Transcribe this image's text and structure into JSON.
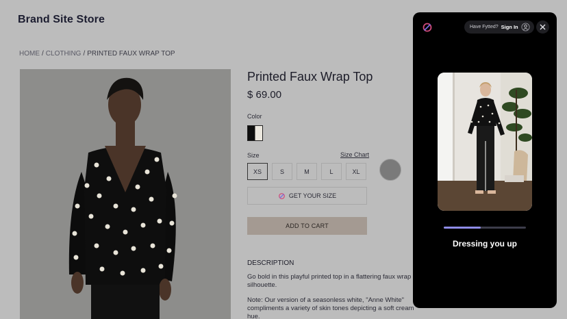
{
  "store": {
    "title": "Brand Site Store"
  },
  "breadcrumb": {
    "home": "HOME",
    "sep": "/",
    "category": "CLOTHING",
    "current": "PRINTED FAUX WRAP TOP"
  },
  "product": {
    "title": "Printed Faux Wrap Top",
    "price": "$ 69.00",
    "color_label": "Color",
    "size_label": "Size",
    "size_chart": "Size Chart",
    "sizes": [
      "XS",
      "S",
      "M",
      "L",
      "XL"
    ],
    "selected_size": "XS",
    "get_size_label": "GET YOUR SIZE",
    "add_to_cart_label": "ADD TO CART",
    "description_heading": "DESCRIPTION",
    "description_1": "Go bold in this playful printed top in a flattering faux wrap silhouette.",
    "description_2": "Note: Our version of a seasonless white, \"Anne White\" compliments a variety of skin tones depicting a soft cream hue."
  },
  "panel": {
    "have_fytted": "Have Fytted?",
    "sign_in": "Sign In",
    "status": "Dressing you up",
    "progress": 0.45
  },
  "colors": {
    "accent": "#8f8ce8",
    "panel_bg": "#000000",
    "cart_button": "#a49a92",
    "page_overlay": "#bcbcbc"
  }
}
